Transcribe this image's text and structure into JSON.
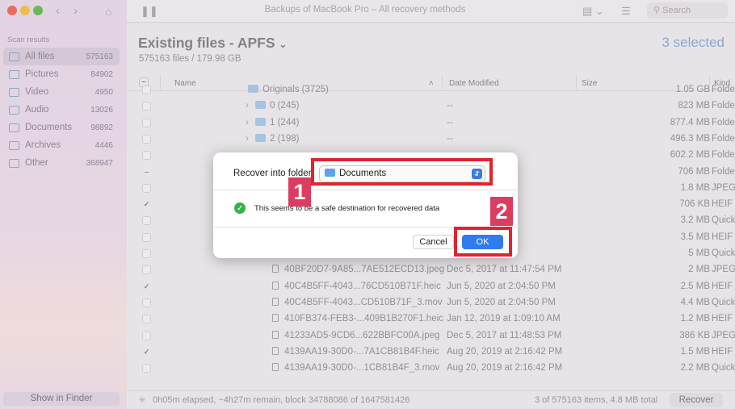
{
  "window": {
    "title": "Backups of MacBook Pro – All recovery methods"
  },
  "toolbar": {
    "search_placeholder": "Search"
  },
  "sidebar": {
    "section_label": "Scan results",
    "items": [
      {
        "label": "All files",
        "count": "575163",
        "icon": "all-files-icon"
      },
      {
        "label": "Pictures",
        "count": "84902",
        "icon": "pictures-icon"
      },
      {
        "label": "Video",
        "count": "4950",
        "icon": "video-icon"
      },
      {
        "label": "Audio",
        "count": "13026",
        "icon": "audio-icon"
      },
      {
        "label": "Documents",
        "count": "98892",
        "icon": "documents-icon"
      },
      {
        "label": "Archives",
        "count": "4446",
        "icon": "archives-icon"
      },
      {
        "label": "Other",
        "count": "368947",
        "icon": "other-icon"
      }
    ],
    "show_in_finder": "Show in Finder"
  },
  "main": {
    "title": "Existing files - APFS",
    "subtitle": "575163 files / 179.98 GB",
    "selected": "3 selected",
    "columns": {
      "name": "Name",
      "date": "Date Modified",
      "size": "Size",
      "kind": "Kind"
    },
    "rows": [
      {
        "name": "Originals (3725)",
        "date": "",
        "size": "1.05 GB",
        "kind": "Folder",
        "type": "folder",
        "checked": false
      },
      {
        "name": "0 (245)",
        "date": "--",
        "size": "823 MB",
        "kind": "Folder",
        "type": "folder",
        "checked": false
      },
      {
        "name": "1 (244)",
        "date": "--",
        "size": "877.4 MB",
        "kind": "Folder",
        "type": "folder",
        "checked": false
      },
      {
        "name": "2 (198)",
        "date": "--",
        "size": "496.3 MB",
        "kind": "Folder",
        "type": "folder",
        "checked": false
      },
      {
        "name": "",
        "date": "",
        "size": "602.2 MB",
        "kind": "Folder",
        "type": "folder",
        "checked": false
      },
      {
        "name": "",
        "date": "",
        "size": "706 MB",
        "kind": "Folder",
        "type": "folder",
        "checked": "partial"
      },
      {
        "name": "",
        "date": "29:10 PM",
        "size": "1.8 MB",
        "kind": "JPEG",
        "type": "file",
        "checked": false
      },
      {
        "name": "",
        "date": "52:47 AM",
        "size": "706 KB",
        "kind": "HEIF I",
        "type": "file",
        "checked": true
      },
      {
        "name": "",
        "date": "52:47 AM",
        "size": "3.2 MB",
        "kind": "Quick",
        "type": "file",
        "checked": false
      },
      {
        "name": "",
        "date": "49:29 PM",
        "size": "3.5 MB",
        "kind": "HEIF I",
        "type": "file",
        "checked": false
      },
      {
        "name": "",
        "date": "57:59 PM",
        "size": "5 MB",
        "kind": "Quick",
        "type": "file",
        "checked": false
      },
      {
        "name": "40BF20D7-9A85...7AE512ECD13.jpeg",
        "date": "Dec 5, 2017 at 11:47:54 PM",
        "size": "2 MB",
        "kind": "JPEG",
        "type": "file",
        "checked": false
      },
      {
        "name": "40C4B5FF-4043...76CD510B71F.heic",
        "date": "Jun 5, 2020 at 2:04:50 PM",
        "size": "2.5 MB",
        "kind": "HEIF I",
        "type": "file",
        "checked": true
      },
      {
        "name": "40C4B5FF-4043...CD510B71F_3.mov",
        "date": "Jun 5, 2020 at 2:04:50 PM",
        "size": "4.4 MB",
        "kind": "Quick",
        "type": "file",
        "checked": false
      },
      {
        "name": "410FB374-FEB3-...409B1B270F1.heic",
        "date": "Jan 12, 2019 at 1:09:10 AM",
        "size": "1.2 MB",
        "kind": "HEIF I",
        "type": "file",
        "checked": false
      },
      {
        "name": "41233AD5-9CD6...622BBFC00A.jpeg",
        "date": "Dec 5, 2017 at 11:48:53 PM",
        "size": "386 KB",
        "kind": "JPEG",
        "type": "file",
        "checked": false
      },
      {
        "name": "4139AA19-30D0-...7A1CB81B4F.heic",
        "date": "Aug 20, 2019 at 2:16:42 PM",
        "size": "1.5 MB",
        "kind": "HEIF I",
        "type": "file",
        "checked": true
      },
      {
        "name": "4139AA19-30D0-...1CB81B4F_3.mov",
        "date": "Aug 20, 2019 at 2:16:42 PM",
        "size": "2.2 MB",
        "kind": "Quick",
        "type": "file",
        "checked": false
      }
    ]
  },
  "status": {
    "elapsed": "0h05m elapsed, ~4h27m remain, block 34788086 of 1647581426",
    "totals": "3 of 575163 items, 4.8 MB total",
    "recover": "Recover"
  },
  "dialog": {
    "label": "Recover into folder",
    "folder": "Documents",
    "message": "This seems to be a safe destination for recovered data",
    "cancel": "Cancel",
    "ok": "OK"
  },
  "annotations": {
    "step1": "1",
    "step2": "2",
    "color": "#e0242e"
  }
}
